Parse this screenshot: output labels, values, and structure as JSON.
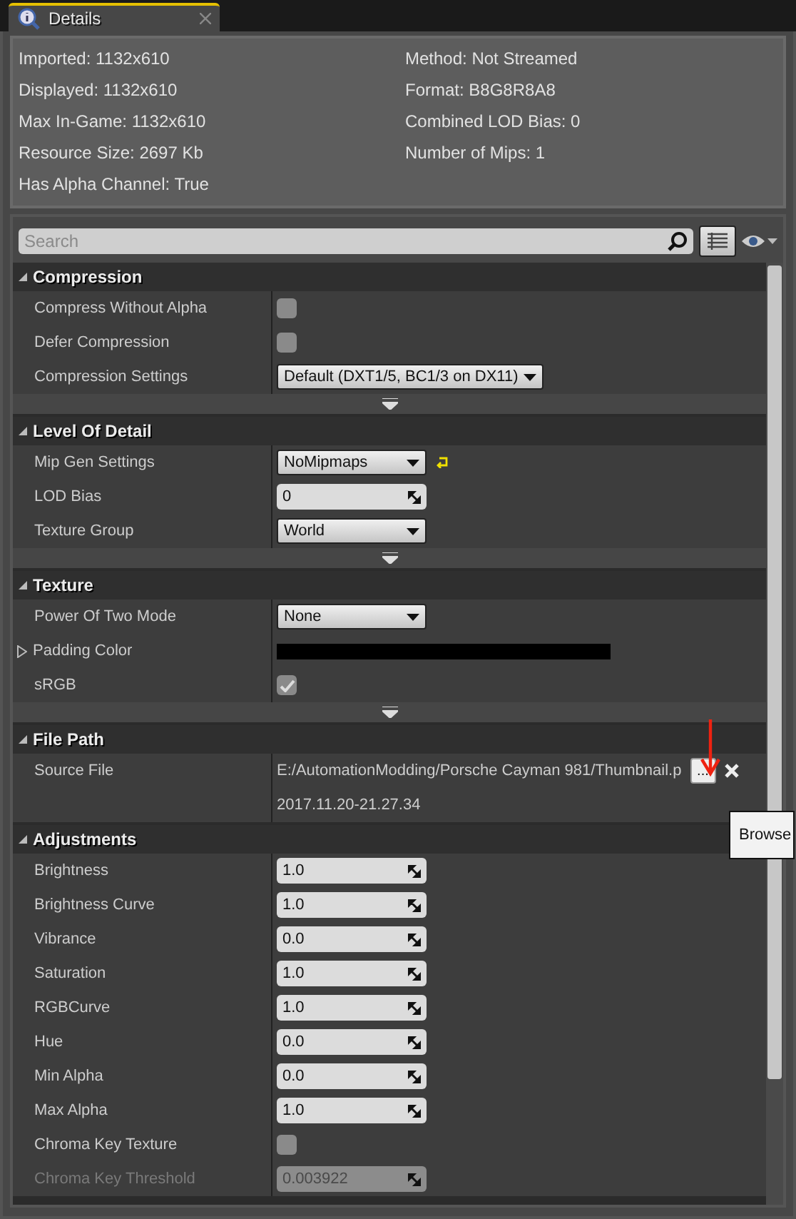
{
  "tab": {
    "title": "Details",
    "selected": true
  },
  "info": {
    "left": [
      "Imported: 1132x610",
      "Displayed: 1132x610",
      "Max In-Game: 1132x610",
      "Resource Size: 2697 Kb",
      "Has Alpha Channel: True"
    ],
    "right": [
      "Method: Not Streamed",
      "Format: B8G8R8A8",
      "Combined LOD Bias: 0",
      "Number of Mips: 1"
    ]
  },
  "search": {
    "placeholder": "Search"
  },
  "sections": [
    {
      "title": "Compression",
      "expanded": true,
      "show_more": true,
      "rows": [
        {
          "label": "Compress Without Alpha",
          "kind": "checkbox",
          "checked": false
        },
        {
          "label": "Defer Compression",
          "kind": "checkbox",
          "checked": false
        },
        {
          "label": "Compression Settings",
          "kind": "dropdown",
          "value": "Default (DXT1/5, BC1/3 on DX11)"
        }
      ]
    },
    {
      "title": "Level Of Detail",
      "expanded": true,
      "show_more": true,
      "rows": [
        {
          "label": "Mip Gen Settings",
          "kind": "dropdown",
          "value": "NoMipmaps",
          "reset": true
        },
        {
          "label": "LOD Bias",
          "kind": "number",
          "value": "0"
        },
        {
          "label": "Texture Group",
          "kind": "dropdown",
          "value": "World"
        }
      ]
    },
    {
      "title": "Texture",
      "expanded": true,
      "show_more": true,
      "rows": [
        {
          "label": "Power Of Two Mode",
          "kind": "dropdown",
          "value": "None"
        },
        {
          "label": "Padding Color",
          "kind": "color",
          "color": "#000000",
          "expanded": false
        },
        {
          "label": "sRGB",
          "kind": "checkbox",
          "checked": true
        }
      ]
    },
    {
      "title": "File Path",
      "expanded": true,
      "show_more": false,
      "rows": [
        {
          "label": "Source File",
          "kind": "file",
          "value": "E:/AutomationModding/Porsche Cayman 981/Thumbnail.p",
          "button": "...",
          "tooltip": "Browse"
        },
        {
          "kind": "text",
          "value": "2017.11.20-21.27.34"
        }
      ]
    },
    {
      "title": "Adjustments",
      "expanded": true,
      "show_more": false,
      "rows": [
        {
          "label": "Brightness",
          "kind": "number",
          "value": "1.0",
          "disabled": false
        },
        {
          "label": "Brightness Curve",
          "kind": "number",
          "value": "1.0",
          "disabled": false
        },
        {
          "label": "Vibrance",
          "kind": "number",
          "value": "0.0",
          "disabled": false
        },
        {
          "label": "Saturation",
          "kind": "number",
          "value": "1.0",
          "disabled": false
        },
        {
          "label": "RGBCurve",
          "kind": "number",
          "value": "1.0",
          "disabled": false
        },
        {
          "label": "Hue",
          "kind": "number",
          "value": "0.0",
          "disabled": false
        },
        {
          "label": "Min Alpha",
          "kind": "number",
          "value": "0.0",
          "disabled": false
        },
        {
          "label": "Max Alpha",
          "kind": "number",
          "value": "1.0",
          "disabled": false
        },
        {
          "label": "Chroma Key Texture",
          "kind": "checkbox",
          "checked": false,
          "disabled": false
        },
        {
          "label": "Chroma Key Threshold",
          "kind": "number",
          "value": "0.003922",
          "disabled": true
        }
      ]
    }
  ]
}
